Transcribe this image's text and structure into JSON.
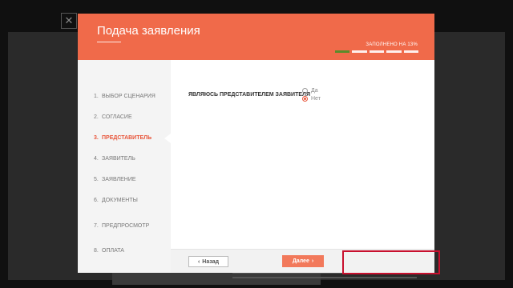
{
  "dialog": {
    "title": "Подача заявления",
    "progress_label": "ЗАПОЛНЕНО НА 13%",
    "progress_percent": 13,
    "progress_segments": 5,
    "progress_done": 1,
    "close_icon": "close-icon"
  },
  "steps": [
    {
      "num": "1.",
      "label": "ВЫБОР СЦЕНАРИЯ",
      "active": false
    },
    {
      "num": "2.",
      "label": "СОГЛАСИЕ",
      "active": false
    },
    {
      "num": "3.",
      "label": "ПРЕДСТАВИТЕЛЬ",
      "active": true
    },
    {
      "num": "4.",
      "label": "ЗАЯВИТЕЛЬ",
      "active": false
    },
    {
      "num": "5.",
      "label": "ЗАЯВЛЕНИЕ",
      "active": false
    },
    {
      "num": "6.",
      "label": "ДОКУМЕНТЫ",
      "active": false
    },
    {
      "num": "7.",
      "label": "ПРЕДПРОСМОТР",
      "active": false
    },
    {
      "num": "8.",
      "label": "ОПЛАТА",
      "active": false
    }
  ],
  "question": {
    "text": "ЯВЛЯЮСЬ ПРЕДСТАВИТЕЛЕМ ЗАЯВИТЕЛЯ",
    "options": [
      {
        "label": "Да",
        "checked": false
      },
      {
        "label": "Нет",
        "checked": true
      }
    ]
  },
  "footer": {
    "back_label": "Назад",
    "next_label": "Далее",
    "back_icon": "chevron-left-icon",
    "next_icon": "chevron-right-icon"
  },
  "colors": {
    "accent": "#f06a4a",
    "active_step": "#e8553a",
    "progress_done": "#5a8b2a",
    "highlight": "#c8102e"
  }
}
